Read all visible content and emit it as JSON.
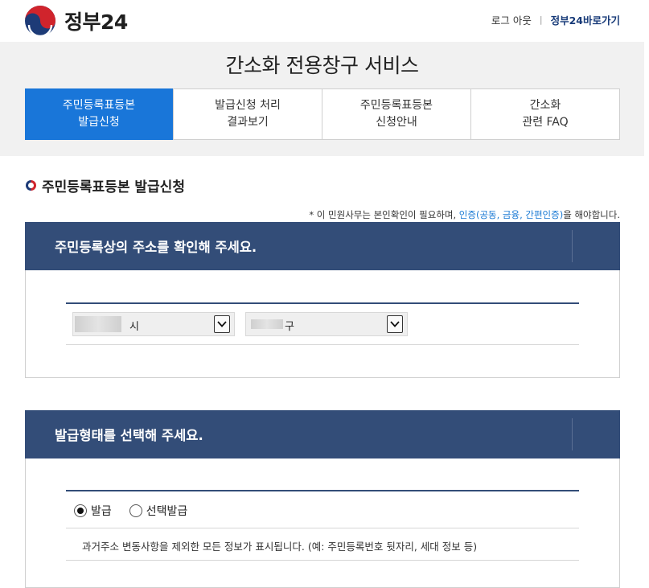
{
  "header": {
    "logo_text": "정부24",
    "logout_label": "로그 아웃",
    "separator": "|",
    "gov24_link_label": "정부24바로가기"
  },
  "service": {
    "title": "간소화 전용창구 서비스",
    "tabs": [
      {
        "line1": "주민등록표등본",
        "line2": "발급신청",
        "active": true
      },
      {
        "line1": "발급신청 처리",
        "line2": "결과보기",
        "active": false
      },
      {
        "line1": "주민등록표등본",
        "line2": "신청안내",
        "active": false
      },
      {
        "line1": "간소화",
        "line2": "관련 FAQ",
        "active": false
      }
    ]
  },
  "section": {
    "title": "주민등록표등본 발급신청",
    "notice_prefix": "* 이 민원사무는 본인확인이 필요하며,",
    "notice_link": "인증(공동, 금융, 간편인증)",
    "notice_suffix": "을 해야합니다."
  },
  "address_panel": {
    "heading": "주민등록상의 주소를 확인해 주세요.",
    "city_select_value": "시",
    "district_select_value": "구"
  },
  "issue_panel": {
    "heading": "발급형태를 선택해 주세요.",
    "options": [
      {
        "label": "발급",
        "selected": true
      },
      {
        "label": "선택발급",
        "selected": false
      }
    ],
    "description": "과거주소 변동사항을 제외한 모든 정보가 표시됩니다. (예: 주민등록번호 뒷자리, 세대 정보 등)"
  },
  "colors": {
    "active_tab": "#1976d9",
    "panel_header": "#334d78",
    "link_blue": "#1a7ad4",
    "logo_red": "#d0242c",
    "logo_blue": "#1d3b77"
  }
}
